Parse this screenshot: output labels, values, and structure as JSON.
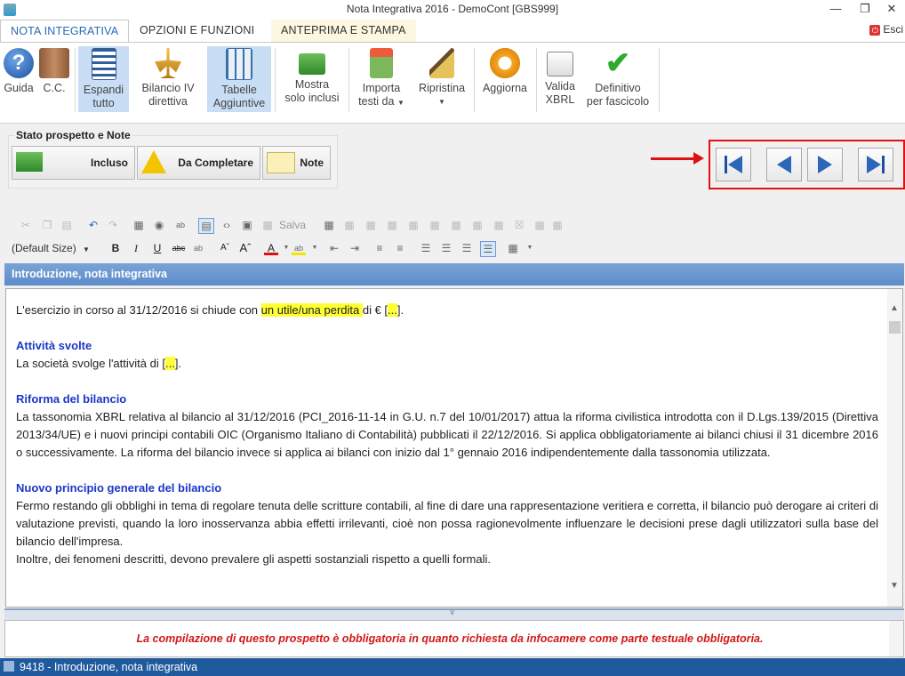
{
  "window": {
    "title": "Nota Integrativa 2016 - DemoCont [GBS999]"
  },
  "menu": {
    "tabs": [
      "NOTA INTEGRATIVA",
      "OPZIONI E FUNZIONI",
      "ANTEPRIMA E STAMPA"
    ],
    "exit_label": "Esci"
  },
  "ribbon": {
    "guida": "Guida",
    "cc": "C.C.",
    "espandi_1": "Espandi",
    "espandi_2": "tutto",
    "bilancio_1": "Bilancio IV",
    "bilancio_2": "direttiva",
    "tabelle_1": "Tabelle",
    "tabelle_2": "Aggiuntive",
    "mostra_1": "Mostra",
    "mostra_2": "solo inclusi",
    "importa_1": "Importa",
    "importa_2": "testi da",
    "ripristina": "Ripristina",
    "aggiorna": "Aggiorna",
    "valida_1": "Valida",
    "valida_2": "XBRL",
    "definitivo_1": "Definitivo",
    "definitivo_2": "per fascicolo"
  },
  "stato": {
    "title": "Stato prospetto e Note",
    "incluso": "Incluso",
    "completare": "Da Completare",
    "note": "Note"
  },
  "toolbar": {
    "save_label": "Salva",
    "font_size": "(Default Size)"
  },
  "section": {
    "title": "Introduzione, nota integrativa"
  },
  "doc": {
    "p1_pre": "L'esercizio in corso al 31/12/2016 si chiude con ",
    "p1_hl": "un utile/una perdita ",
    "p1_mid": "di € [",
    "p1_hl2": "...",
    "p1_end": "].",
    "h1": "Attività svolte",
    "p2_pre": "La società svolge l'attività di [",
    "p2_hl": "...",
    "p2_end": "].",
    "h2": "Riforma del bilancio",
    "p3": "La tassonomia XBRL relativa al bilancio al 31/12/2016 (PCI_2016-11-14 in G.U. n.7 del 10/01/2017) attua la riforma civilistica introdotta con il D.Lgs.139/2015 (Direttiva 2013/34/UE) e i nuovi principi contabili OIC (Organismo Italiano di Contabilità) pubblicati il 22/12/2016. Si applica obbligatoriamente ai bilanci chiusi il 31 dicembre 2016 o successivamente. La riforma del bilancio invece si applica ai bilanci con inizio dal 1° gennaio 2016 indipendentemente dalla tassonomia utilizzata.",
    "h3": "Nuovo principio generale del bilancio",
    "p4": "Fermo restando gli obblighi in tema di regolare tenuta delle scritture contabili, al fine di dare una rappresentazione veritiera e corretta, il bilancio può derogare ai criteri di valutazione previsti, quando la loro inosservanza abbia effetti irrilevanti, cioè non possa ragionevolmente influenzare le decisioni prese dagli utilizzatori sulla base del bilancio dell'impresa.",
    "p5": "Inoltre, dei fenomeni descritti, devono prevalere gli aspetti sostanziali rispetto a quelli formali."
  },
  "bottom": {
    "message": "La compilazione di questo prospetto è obbligatoria in quanto richiesta da infocamere come parte testuale obbligatoria."
  },
  "status": {
    "text": "9418 - Introduzione, nota integrativa"
  }
}
